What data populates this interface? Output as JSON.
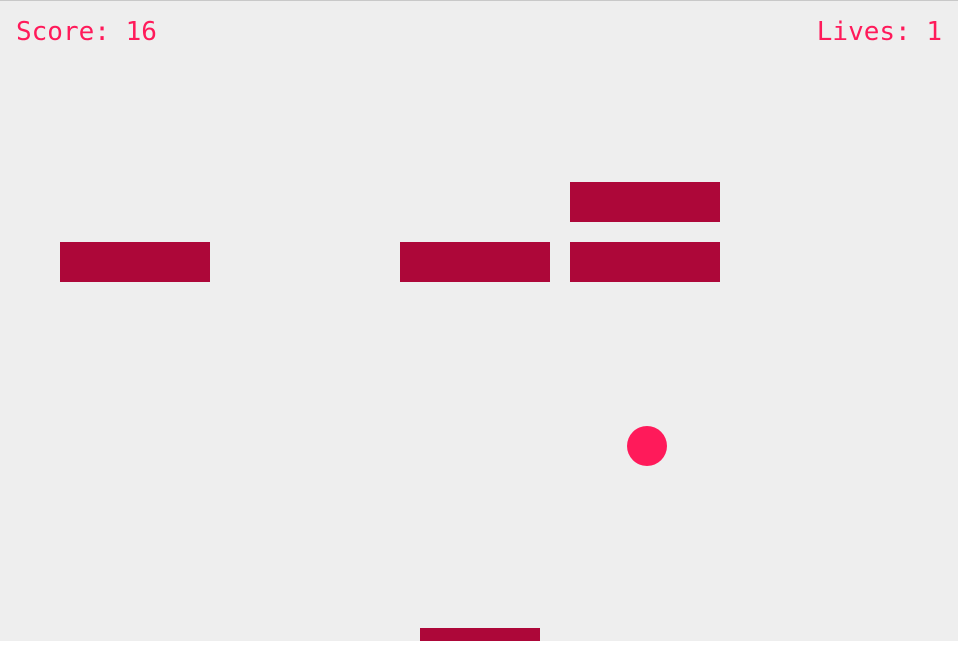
{
  "hud": {
    "score_label": "Score:",
    "score_value": "16",
    "lives_label": "Lives:",
    "lives_value": "1"
  },
  "colors": {
    "background": "#eeeeee",
    "hud_text": "#ff1a5a",
    "brick": "#ad0739",
    "ball": "#ff1a5a",
    "paddle": "#ad0739"
  }
}
